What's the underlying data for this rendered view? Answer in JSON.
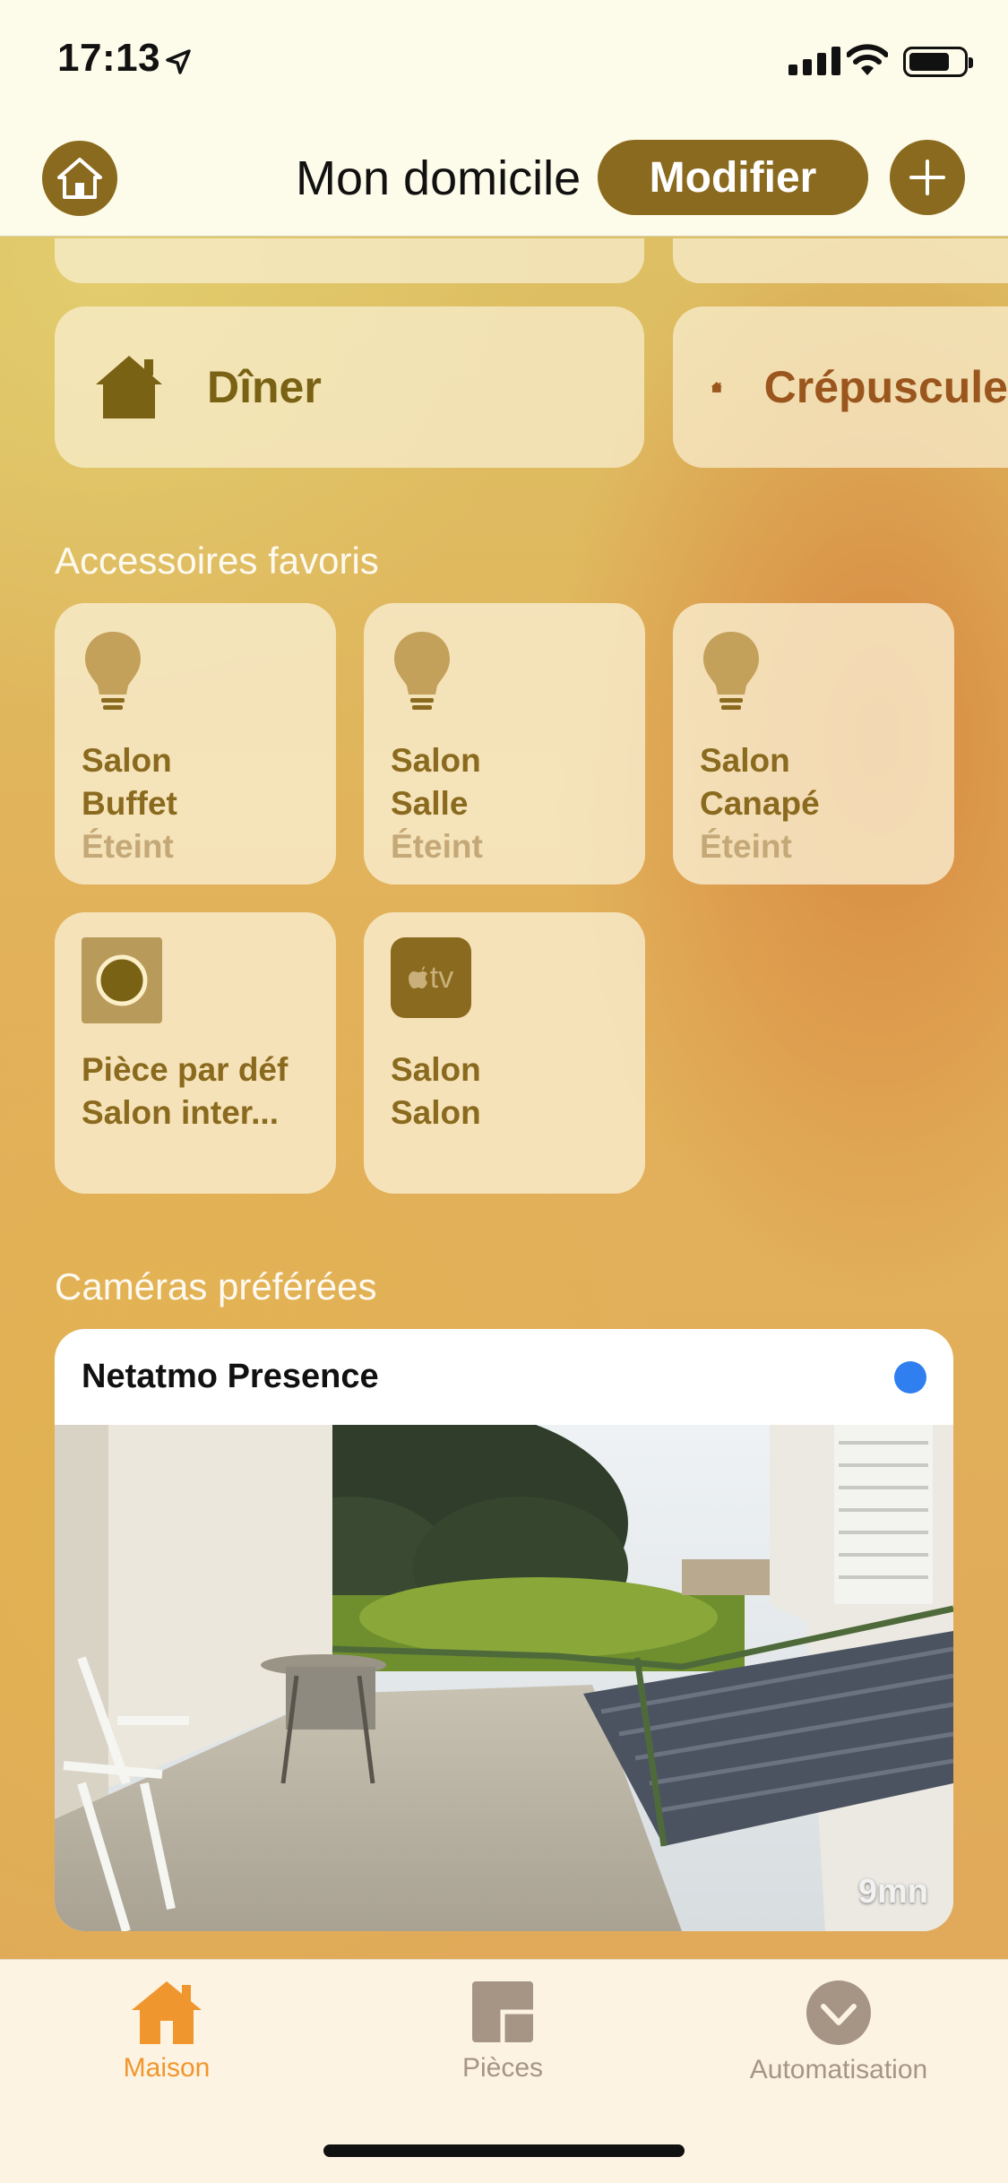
{
  "status_bar": {
    "time": "17:13"
  },
  "header": {
    "title": "Mon domicile",
    "modify_label": "Modifier"
  },
  "scenes": [
    {
      "label": "Dîner",
      "color": "#7a6214"
    },
    {
      "label": "Crépuscule",
      "color": "#9a561c"
    }
  ],
  "sections": {
    "accessories_title": "Accessoires favoris",
    "cameras_title": "Caméras préférées"
  },
  "accessories": [
    {
      "line1": "Salon",
      "line2": "Buffet",
      "state": "Éteint",
      "icon": "lightbulb-icon"
    },
    {
      "line1": "Salon",
      "line2": "Salle",
      "state": "Éteint",
      "icon": "lightbulb-icon"
    },
    {
      "line1": "Salon",
      "line2": "Canapé",
      "state": "Éteint",
      "icon": "lightbulb-icon"
    },
    {
      "line1": "Pièce par déf",
      "line2": "Salon inter...",
      "state": "",
      "icon": "speaker-icon"
    },
    {
      "line1": "Salon",
      "line2": "Salon",
      "state": "",
      "icon": "apple-tv-icon",
      "icon_text": "tv"
    }
  ],
  "camera": {
    "name": "Netatmo Presence",
    "age": "9mn"
  },
  "tabs": [
    {
      "label": "Maison",
      "active": true,
      "icon": "house-icon"
    },
    {
      "label": "Pièces",
      "active": false,
      "icon": "rooms-icon"
    },
    {
      "label": "Automatisation",
      "active": false,
      "icon": "automation-icon"
    }
  ],
  "colors": {
    "accent": "#8a6a1e",
    "active_tab": "#f0962e",
    "inactive_tab": "#a69584",
    "camera_status_dot": "#2f7ff0"
  }
}
